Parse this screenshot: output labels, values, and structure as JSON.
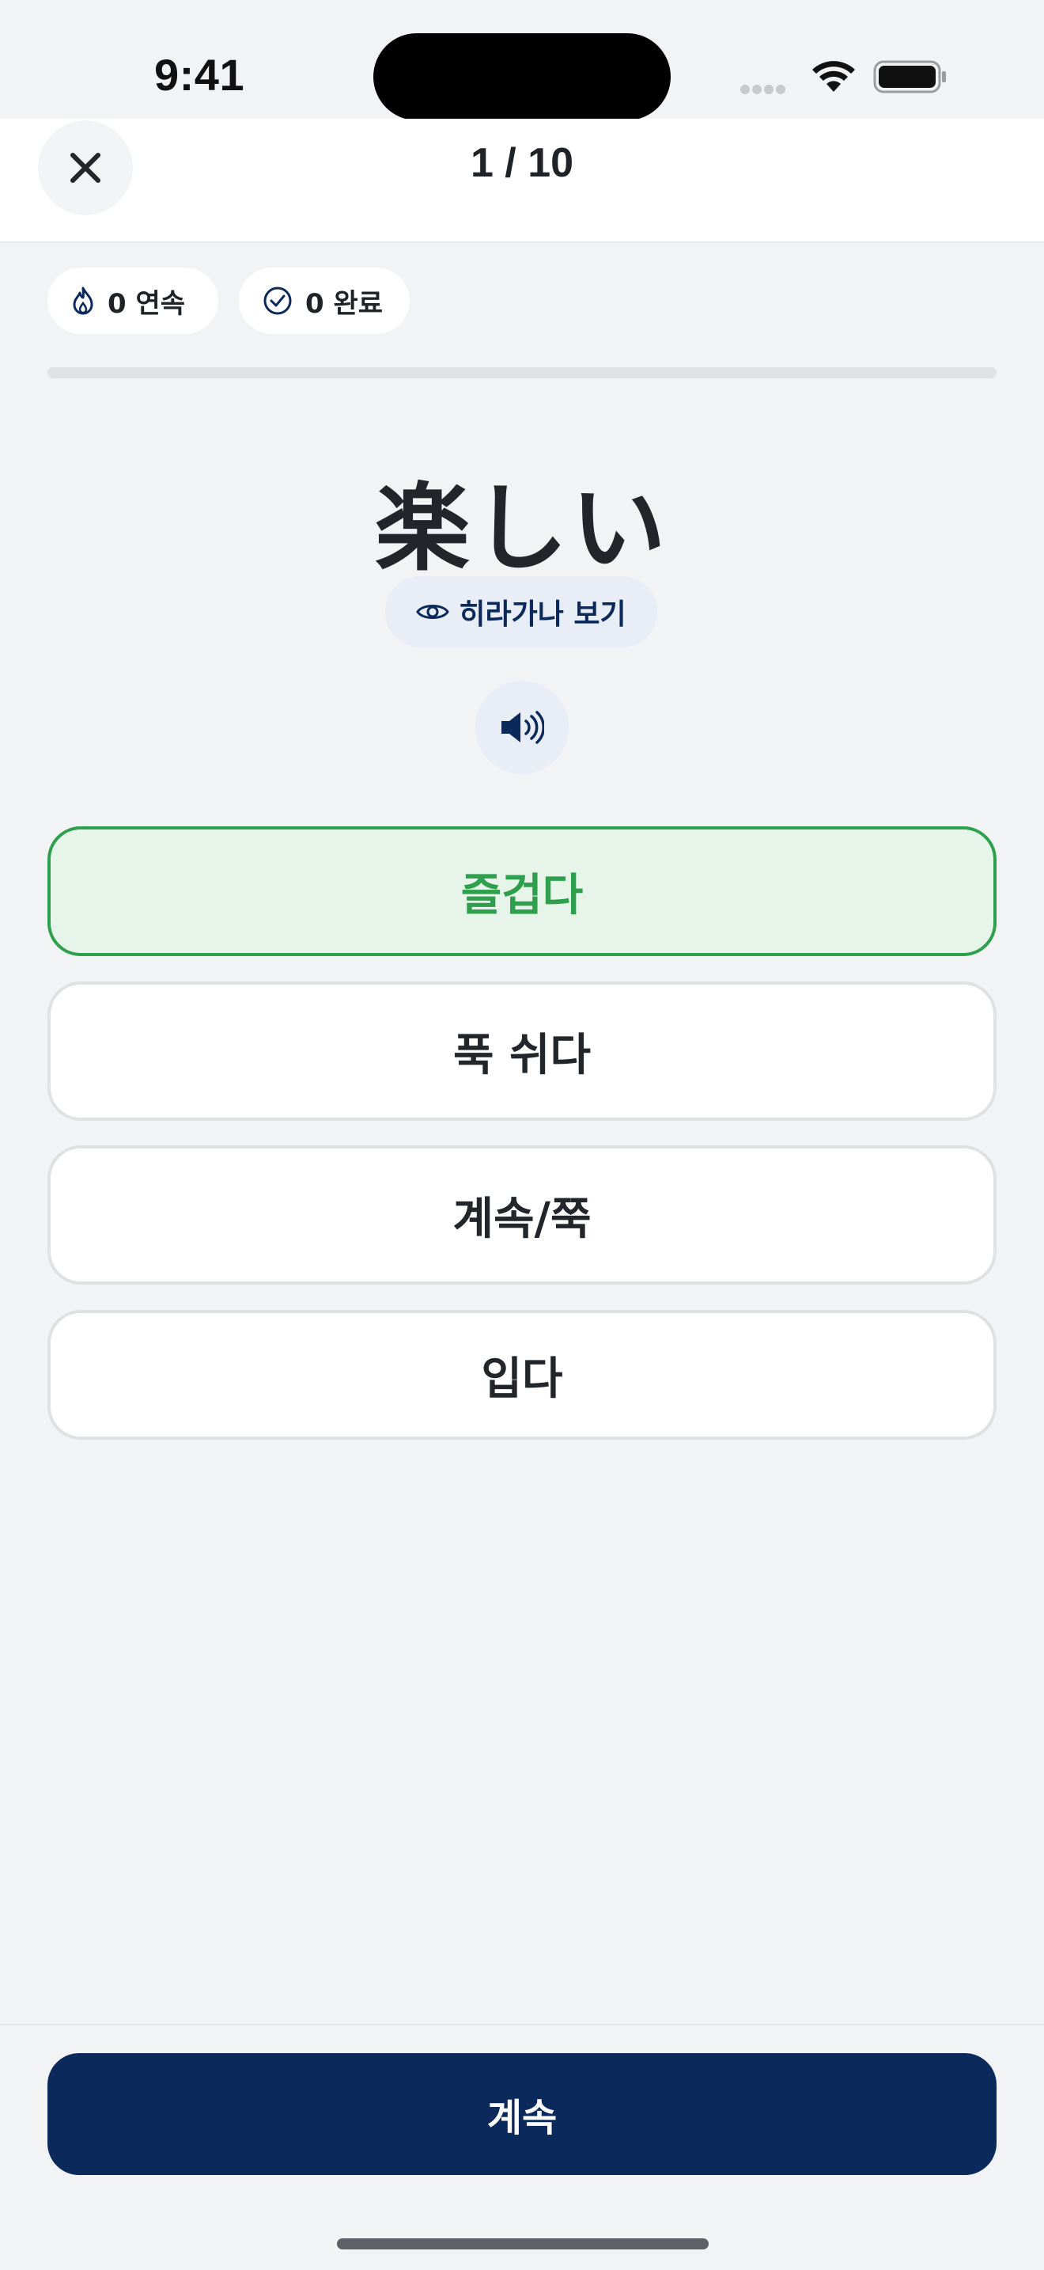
{
  "status_bar": {
    "time": "9:41"
  },
  "header": {
    "close_icon": "close-icon",
    "progress": "1 / 10"
  },
  "stats": {
    "streak": "0 연속",
    "streak_icon": "flame-icon",
    "completed": "0 완료",
    "completed_icon": "check-circle-icon"
  },
  "progress_bar": {
    "fraction": 0
  },
  "question": {
    "word": "楽しい",
    "hiragana_button": "히라가나 보기",
    "hiragana_icon": "eye-icon",
    "audio_icon": "speaker-icon"
  },
  "options": [
    {
      "label": "즐겁다",
      "state": "selected"
    },
    {
      "label": "푹 쉬다",
      "state": "default"
    },
    {
      "label": "계속/쭉",
      "state": "default"
    },
    {
      "label": "입다",
      "state": "default"
    }
  ],
  "footer": {
    "continue_label": "계속"
  },
  "colors": {
    "primary": "#0b2a5b",
    "correct": "#2e9f4c",
    "correct_bg": "#e6f4ea",
    "background": "#f2f3f5"
  }
}
